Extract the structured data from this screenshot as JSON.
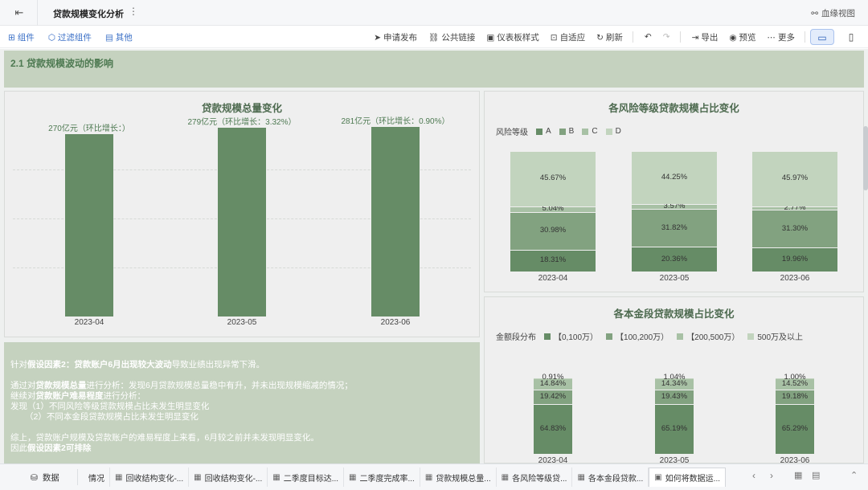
{
  "header": {
    "title": "贷款规模变化分析",
    "more_icon": "⋮",
    "lineage_label": "血缘视图"
  },
  "toolbar": {
    "left": [
      {
        "icon": "component-icon",
        "label": "组件"
      },
      {
        "icon": "filter-component-icon",
        "label": "过滤组件"
      },
      {
        "icon": "other-icon",
        "label": "其他"
      }
    ],
    "right": [
      {
        "icon": "publish-icon",
        "label": "申请发布"
      },
      {
        "icon": "link-icon",
        "label": "公共链接"
      },
      {
        "icon": "style-icon",
        "label": "仪表板样式"
      },
      {
        "icon": "adapt-icon",
        "label": "自适应"
      },
      {
        "icon": "refresh-icon",
        "label": "刷新"
      },
      {
        "icon": "export-icon",
        "label": "导出"
      },
      {
        "icon": "preview-icon",
        "label": "预览"
      },
      {
        "icon": "more-icon",
        "label": "更多"
      }
    ]
  },
  "section": {
    "title": "2.1  贷款规模波动的影响"
  },
  "chart_left": {
    "title": "贷款规模总量变化",
    "chart_data": {
      "type": "bar",
      "categories": [
        "2023-04",
        "2023-05",
        "2023-06"
      ],
      "values": [
        270,
        279,
        281
      ],
      "data_labels": [
        "270亿元（环比增长：）",
        "279亿元（环比增长：3.32%）",
        "281亿元（环比增长：0.90%）"
      ],
      "color": "#668c66"
    }
  },
  "chart_risk": {
    "title": "各风险等级贷款规模占比变化",
    "chart_data": {
      "type": "bar",
      "stacked": true,
      "legend_title": "风险等级",
      "categories": [
        "2023-04",
        "2023-05",
        "2023-06"
      ],
      "series": [
        {
          "name": "A",
          "color": "#668c66",
          "values": [
            18.31,
            20.36,
            19.96
          ]
        },
        {
          "name": "B",
          "color": "#82a280",
          "values": [
            30.98,
            31.82,
            31.3
          ]
        },
        {
          "name": "C",
          "color": "#a8c1a5",
          "values": [
            5.04,
            3.57,
            2.77
          ]
        },
        {
          "name": "D",
          "color": "#c2d4be",
          "values": [
            45.67,
            44.25,
            45.97
          ]
        }
      ]
    }
  },
  "chart_amount": {
    "title": "各本金段贷款规模占比变化",
    "chart_data": {
      "type": "bar",
      "stacked": true,
      "legend_title": "金额段分布",
      "categories": [
        "2023-04",
        "2023-05",
        "2023-06"
      ],
      "series": [
        {
          "name": "【0,100万）",
          "color": "#668c66",
          "values": [
            64.83,
            65.19,
            65.29
          ]
        },
        {
          "name": "【100,200万）",
          "color": "#82a280",
          "values": [
            19.42,
            19.43,
            19.18
          ]
        },
        {
          "name": "【200,500万）",
          "color": "#a8c1a5",
          "values": [
            14.84,
            14.34,
            14.52
          ]
        },
        {
          "name": "500万及以上",
          "color": "#c2d4be",
          "values": [
            0.91,
            1.04,
            1.0
          ]
        }
      ]
    }
  },
  "note": {
    "line1_pre": "针对",
    "line1_bold": "假设因素2：贷款账户6月出现较大波动",
    "line1_post": "导致业绩出现异常下滑。",
    "line2_pre": "通过对",
    "line2_bold": "贷款规模总量",
    "line2_post": "进行分析：发现6月贷款规模总量稳中有升，并未出现规模缩减的情况；",
    "line3_pre": "继续对",
    "line3_bold": "贷款账户难易程度",
    "line3_post": "进行分析：",
    "line4": "发现（1）不同风险等级贷款规模占比未发生明显变化",
    "line5": "（2）不同本金段贷款规模占比未发生明显变化",
    "line6": "综上，贷款账户规模及贷款账户的难易程度上来看，6月较之前并未发现明显变化。",
    "line7_pre": "因此",
    "line7_bold": "假设因素2可排除"
  },
  "bottom": {
    "data_label": "数据",
    "tabs": [
      {
        "label": "情况",
        "icon": "chart-tab-icon",
        "active": false
      },
      {
        "label": "回收结构变化-...",
        "icon": "chart-tab-icon",
        "active": false
      },
      {
        "label": "回收结构变化-...",
        "icon": "chart-tab-icon",
        "active": false
      },
      {
        "label": "二季度目标达...",
        "icon": "chart-tab-icon",
        "active": false
      },
      {
        "label": "二季度完成率...",
        "icon": "chart-tab-icon",
        "active": false
      },
      {
        "label": "贷款规模总量...",
        "icon": "chart-tab-icon",
        "active": false
      },
      {
        "label": "各风险等级贷...",
        "icon": "chart-tab-icon",
        "active": false
      },
      {
        "label": "各本金段贷款...",
        "icon": "chart-tab-icon",
        "active": false
      },
      {
        "label": "如何将数据运...",
        "icon": "dashboard-tab-icon",
        "active": true
      }
    ]
  }
}
